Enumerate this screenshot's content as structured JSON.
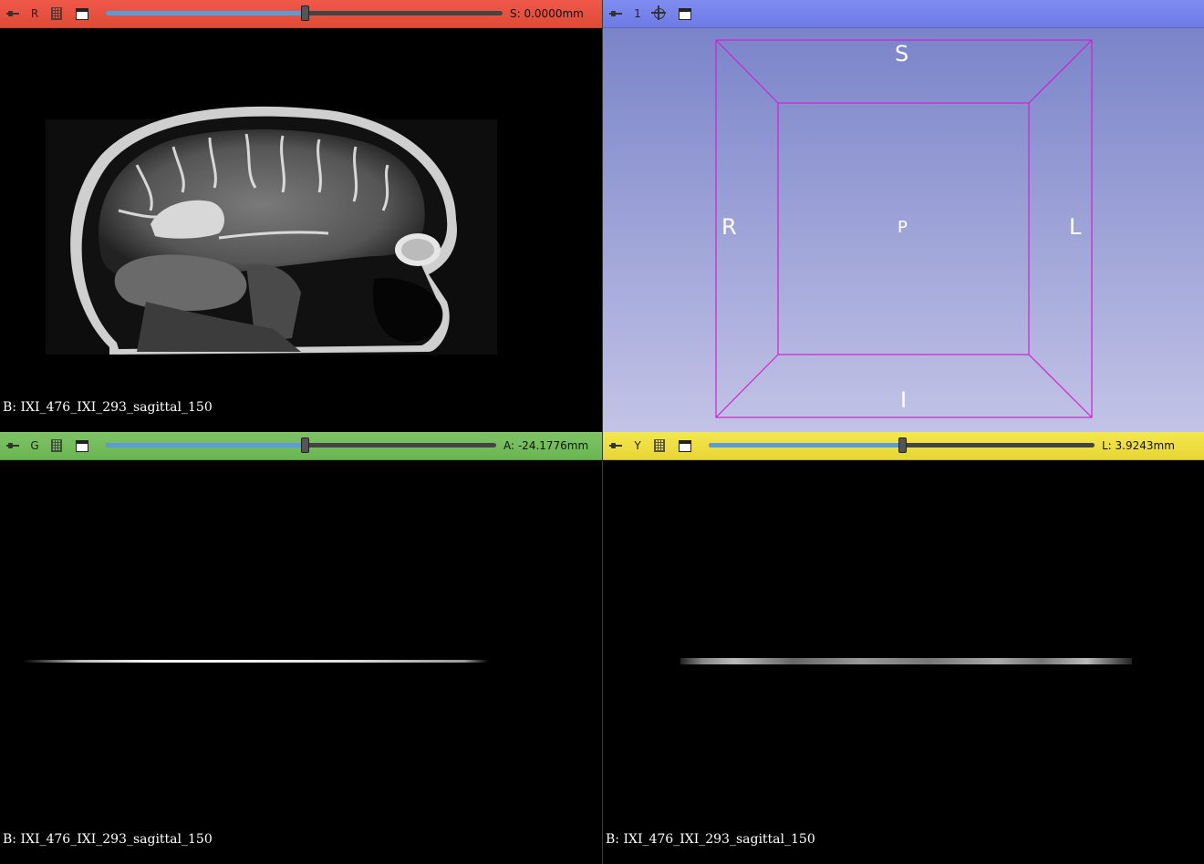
{
  "views": {
    "red": {
      "label": "R",
      "offset": "S: 0.0000mm",
      "slider_fraction": 0.5,
      "background_label": "B: IXI_476_IXI_293_sagittal_150"
    },
    "three_d": {
      "label": "1",
      "orientation": {
        "superior": "S",
        "inferior": "I",
        "right": "R",
        "left": "L",
        "posterior": "P"
      }
    },
    "green": {
      "label": "G",
      "offset": "A: -24.1776mm",
      "slider_fraction": 0.51,
      "background_label": "B: IXI_476_IXI_293_sagittal_150"
    },
    "yellow": {
      "label": "Y",
      "offset": "L: 3.9243mm",
      "slider_fraction": 0.5,
      "background_label": "B: IXI_476_IXI_293_sagittal_150"
    }
  },
  "colors": {
    "red_bar": "#e8503c",
    "blue_bar": "#7380ea",
    "green_bar": "#72bb5a",
    "yellow_bar": "#eedd40",
    "bounding_box": "#d020d0"
  },
  "icons": [
    "pin-icon",
    "link-icon",
    "maximize-view-icon",
    "center-view-icon"
  ]
}
